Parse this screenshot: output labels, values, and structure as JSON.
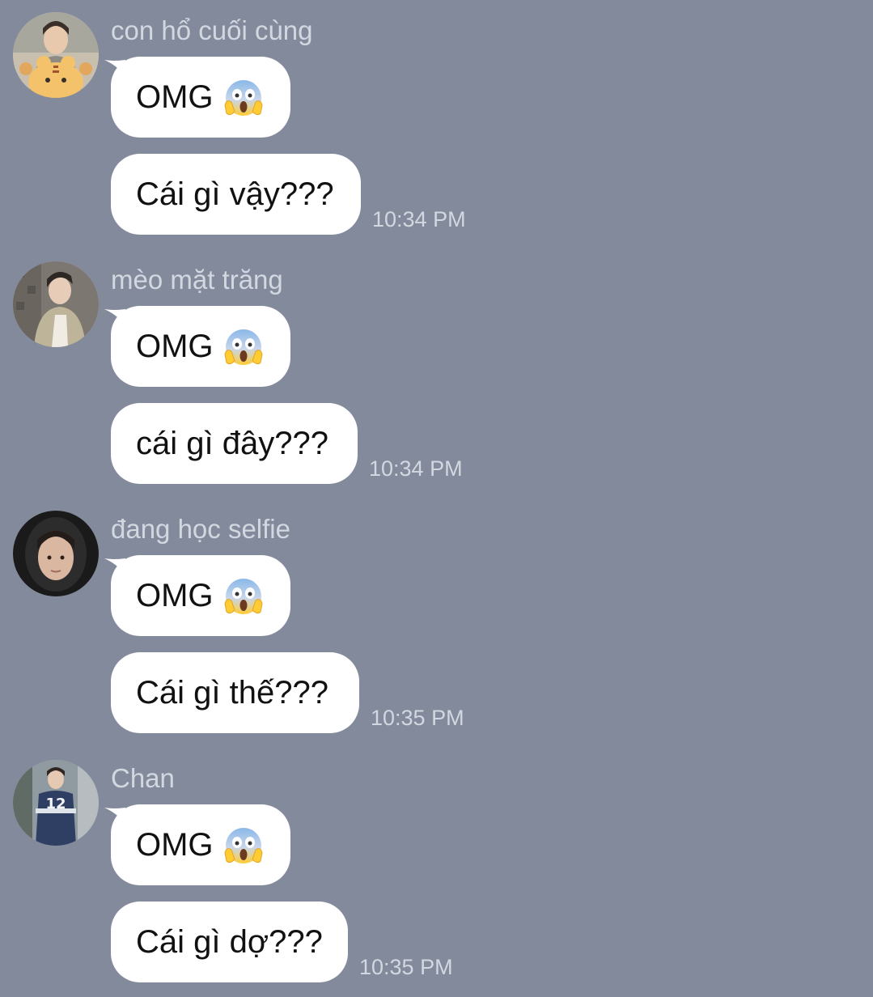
{
  "colors": {
    "background": "#828a9c",
    "bubble": "#ffffff",
    "meta_text": "#d3d7e0"
  },
  "messages": [
    {
      "sender": "con hổ cuối cùng",
      "avatar_icon": "avatar-photo-tiger-icon",
      "first_text": "OMG",
      "first_emoji": "face-screaming-in-fear-icon",
      "second_text": "Cái gì vậy???",
      "time": "10:34 PM"
    },
    {
      "sender": "mèo mặt trăng",
      "avatar_icon": "avatar-photo-icon",
      "first_text": "OMG",
      "first_emoji": "face-screaming-in-fear-icon",
      "second_text": "cái gì đây???",
      "time": "10:34 PM"
    },
    {
      "sender": "đang học selfie",
      "avatar_icon": "avatar-photo-hood-icon",
      "first_text": "OMG",
      "first_emoji": "face-screaming-in-fear-icon",
      "second_text": "Cái gì thế???",
      "time": "10:35 PM"
    },
    {
      "sender": "Chan",
      "avatar_icon": "avatar-photo-jersey-icon",
      "first_text": "OMG",
      "first_emoji": "face-screaming-in-fear-icon",
      "second_text": "Cái gì dợ???",
      "time": "10:35 PM"
    }
  ]
}
